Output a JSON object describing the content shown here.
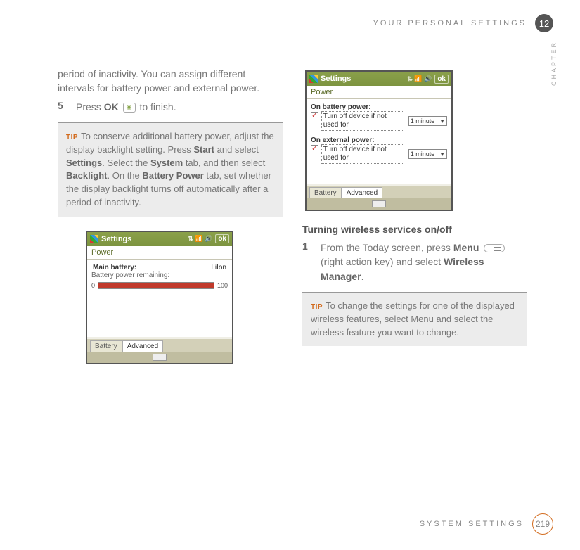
{
  "header": {
    "section_title": "YOUR PERSONAL SETTINGS",
    "chapter_number": "12",
    "chapter_side_label": "CHAPTER"
  },
  "left": {
    "intro_para": "period of inactivity. You can assign different intervals for battery power and external power.",
    "step5_num": "5",
    "step5_a": "Press ",
    "step5_ok": "OK",
    "step5_b": " to finish.",
    "tip_label": "TIP",
    "tip_a": "To conserve additional battery power, adjust the display backlight setting. Press ",
    "tip_b1": "Start",
    "tip_c": " and select ",
    "tip_b2": "Settings",
    "tip_d": ". Select the ",
    "tip_b3": "System",
    "tip_e": " tab, and then select ",
    "tip_b4": "Backlight",
    "tip_f": ". On the ",
    "tip_b5": "Battery Power",
    "tip_g": " tab, set whether the display backlight turns off automatically after a period of inactivity.",
    "shot1": {
      "title": "Settings",
      "ok": "ok",
      "sub": "Power",
      "main_label": "Main battery:",
      "main_type": "LiIon",
      "remaining": "Battery power remaining:",
      "bar_min": "0",
      "bar_max": "100",
      "tab_battery": "Battery",
      "tab_advanced": "Advanced"
    }
  },
  "right": {
    "shot2": {
      "title": "Settings",
      "ok": "ok",
      "sub": "Power",
      "f1_label": "On battery power:",
      "f1_check": "Turn off device if not used for",
      "f1_value": "1 minute",
      "f2_label": "On external power:",
      "f2_check": "Turn off device if not used for",
      "f2_value": "1 minute",
      "tab_battery": "Battery",
      "tab_advanced": "Advanced"
    },
    "subheading": "Turning wireless services on/off",
    "step1_num": "1",
    "step1_a": "From the Today screen, press ",
    "step1_menu": "Menu",
    "step1_b": " (right action key) and select ",
    "step1_wm": "Wireless Manager",
    "step1_c": ".",
    "tip_label": "TIP",
    "tip_text": "To change the settings for one of the displayed wireless features, select Menu and select the wireless feature you want to change."
  },
  "footer": {
    "section_title": "SYSTEM SETTINGS",
    "page_number": "219"
  }
}
